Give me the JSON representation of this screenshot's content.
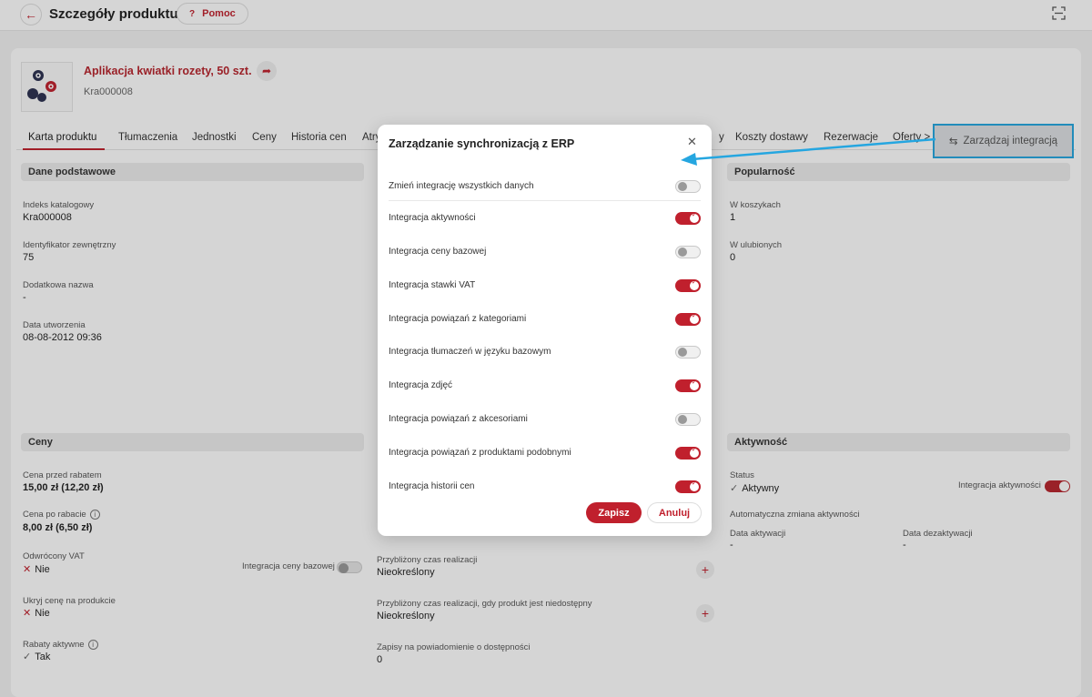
{
  "topbar": {
    "title": "Szczegóły produktu",
    "help_label": "Pomoc",
    "help_glyph": "?"
  },
  "product": {
    "name": "Aplikacja kwiatki rozety, 50 szt.",
    "code": "Kra000008"
  },
  "tabs": [
    {
      "label": "Karta produktu",
      "active": true
    },
    {
      "label": "Tłumaczenia"
    },
    {
      "label": "Jednostki"
    },
    {
      "label": "Ceny"
    },
    {
      "label": "Historia cen"
    },
    {
      "label": "Atry"
    },
    {
      "label": "y"
    },
    {
      "label": "Koszty dostawy"
    },
    {
      "label": "Rezerwacje"
    },
    {
      "label": "Oferty >"
    }
  ],
  "integration_button": {
    "label": "Zarządzaj integracją"
  },
  "basic": {
    "title": "Dane podstawowe",
    "catalog_index_label": "Indeks katalogowy",
    "catalog_index": "Kra000008",
    "external_id_label": "Identyfikator zewnętrzny",
    "external_id": "75",
    "extra_name_label": "Dodatkowa nazwa",
    "extra_name": "-",
    "created_label": "Data utworzenia",
    "created": "08-08-2012 09:36"
  },
  "popularity": {
    "title": "Popularność",
    "in_carts_label": "W koszykach",
    "in_carts": "1",
    "in_favorites_label": "W ulubionych",
    "in_favorites": "0"
  },
  "prices": {
    "title": "Ceny",
    "before_label": "Cena przed rabatem",
    "before": "15,00 zł (12,20 zł)",
    "after_label": "Cena po rabacie",
    "after": "8,00 zł (6,50 zł)",
    "reverse_vat_label": "Odwrócony VAT",
    "reverse_vat": "Nie",
    "base_price_integration_label": "Integracja ceny bazowej",
    "hide_price_label": "Ukryj cenę na produkcie",
    "hide_price": "Nie",
    "discounts_label": "Rabaty aktywne",
    "discounts": "Tak"
  },
  "availability": {
    "eta_label": "Przybliżony czas realizacji",
    "eta": "Nieokreślony",
    "eta_unavailable_label": "Przybliżony czas realizacji, gdy produkt jest niedostępny",
    "eta_unavailable": "Nieokreślony",
    "notify_label": "Zapisy na powiadomienie o dostępności",
    "notify": "0"
  },
  "activity": {
    "title": "Aktywność",
    "status_label": "Status",
    "status": "Aktywny",
    "integration_label": "Integracja aktywności",
    "auto_change_label": "Automatyczna zmiana aktywności",
    "activation_label": "Data aktywacji",
    "activation": "-",
    "deactivation_label": "Data dezaktywacji",
    "deactivation": "-"
  },
  "modal": {
    "title": "Zarządzanie synchronizacją z ERP",
    "rows": [
      {
        "label": "Zmień integrację wszystkich danych",
        "on": false
      },
      {
        "label": "Integracja aktywności",
        "on": true
      },
      {
        "label": "Integracja ceny bazowej",
        "on": false
      },
      {
        "label": "Integracja stawki VAT",
        "on": true
      },
      {
        "label": "Integracja powiązań z kategoriami",
        "on": true
      },
      {
        "label": "Integracja tłumaczeń w języku bazowym",
        "on": false
      },
      {
        "label": "Integracja zdjęć",
        "on": true
      },
      {
        "label": "Integracja powiązań z akcesoriami",
        "on": false
      },
      {
        "label": "Integracja powiązań z produktami podobnymi",
        "on": true
      },
      {
        "label": "Integracja historii cen",
        "on": true
      }
    ],
    "save_label": "Zapisz",
    "cancel_label": "Anuluj"
  },
  "colors": {
    "accent": "#c0202d",
    "highlight": "#25a6e0"
  },
  "icons": [
    "back-arrow-icon",
    "help-icon",
    "scan-icon",
    "share-icon",
    "sync-icon",
    "close-icon",
    "info-icon",
    "plus-icon",
    "check-icon",
    "cross-icon"
  ]
}
